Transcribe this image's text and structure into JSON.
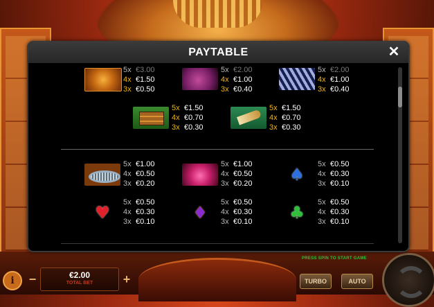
{
  "paytable": {
    "title": "PAYTABLE",
    "close_label": "✕",
    "row1": [
      {
        "symbol": "lion",
        "pays": [
          {
            "mult": "5x",
            "value": "€3.00"
          },
          {
            "mult": "4x",
            "value": "€1.50"
          },
          {
            "mult": "3x",
            "value": "€0.50"
          }
        ]
      },
      {
        "symbol": "rhino",
        "pays": [
          {
            "mult": "5x",
            "value": "€2.00"
          },
          {
            "mult": "4x",
            "value": "€1.00"
          },
          {
            "mult": "3x",
            "value": "€0.40"
          }
        ]
      },
      {
        "symbol": "zebra",
        "pays": [
          {
            "mult": "5x",
            "value": "€2.00"
          },
          {
            "mult": "4x",
            "value": "€1.00"
          },
          {
            "mult": "3x",
            "value": "€0.40"
          }
        ]
      }
    ],
    "row2": [
      {
        "symbol": "treasure-chest",
        "pays": [
          {
            "mult": "5x",
            "value": "€1.50"
          },
          {
            "mult": "4x",
            "value": "€0.70"
          },
          {
            "mult": "3x",
            "value": "€0.30"
          }
        ]
      },
      {
        "symbol": "horn",
        "pays": [
          {
            "mult": "5x",
            "value": "€1.50"
          },
          {
            "mult": "4x",
            "value": "€0.70"
          },
          {
            "mult": "3x",
            "value": "€0.30"
          }
        ]
      }
    ],
    "row3": [
      {
        "symbol": "bracelet",
        "pays": [
          {
            "mult": "5x",
            "value": "€1.00"
          },
          {
            "mult": "4x",
            "value": "€0.50"
          },
          {
            "mult": "3x",
            "value": "€0.20"
          }
        ]
      },
      {
        "symbol": "flower",
        "pays": [
          {
            "mult": "5x",
            "value": "€1.00"
          },
          {
            "mult": "4x",
            "value": "€0.50"
          },
          {
            "mult": "3x",
            "value": "€0.20"
          }
        ]
      },
      {
        "symbol": "spade",
        "glyph": "♠",
        "color": "#2b6fe0",
        "pays": [
          {
            "mult": "5x",
            "value": "€0.50"
          },
          {
            "mult": "4x",
            "value": "€0.30"
          },
          {
            "mult": "3x",
            "value": "€0.10"
          }
        ]
      }
    ],
    "row4": [
      {
        "symbol": "heart",
        "glyph": "♥",
        "color": "#e0202a",
        "pays": [
          {
            "mult": "5x",
            "value": "€0.50"
          },
          {
            "mult": "4x",
            "value": "€0.30"
          },
          {
            "mult": "3x",
            "value": "€0.10"
          }
        ]
      },
      {
        "symbol": "diamond",
        "glyph": "♦",
        "color": "#8a2bd0",
        "pays": [
          {
            "mult": "5x",
            "value": "€0.50"
          },
          {
            "mult": "4x",
            "value": "€0.30"
          },
          {
            "mult": "3x",
            "value": "€0.10"
          }
        ]
      },
      {
        "symbol": "club",
        "glyph": "♣",
        "color": "#2fbf3a",
        "pays": [
          {
            "mult": "5x",
            "value": "€0.50"
          },
          {
            "mult": "4x",
            "value": "€0.30"
          },
          {
            "mult": "3x",
            "value": "€0.10"
          }
        ]
      }
    ]
  },
  "controls": {
    "info_label": "i",
    "minus_label": "−",
    "plus_label": "+",
    "bet_value": "€2.00",
    "bet_label": "TOTAL BET",
    "turbo_label": "TURBO",
    "auto_label": "AUTO",
    "hint": "PRESS SPIN TO START GAME"
  },
  "colors": {
    "accent_multiplier": "#f1b40c",
    "modal_bg": "#000000",
    "header_bg": "#2e2e2e"
  }
}
